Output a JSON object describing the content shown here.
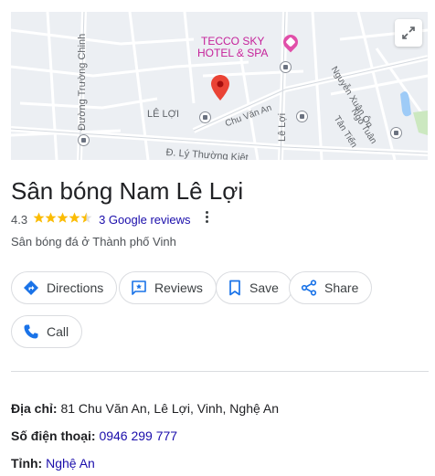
{
  "map": {
    "poi_name_line1": "TECCO SKY",
    "poi_name_line2": "HOTEL & SPA",
    "streets": {
      "duong_truong_chinh": "Đường Trường Chinh",
      "le_loi_area": "LÊ LỢI",
      "chu_van_an": "Chu Văn An",
      "le_loi_street": "Lê Lợi",
      "nguyen_xuan_on": "Nguyễn Xuân Ôn",
      "ngo_tuan": "Ngô Tuân",
      "tan_tien": "Tân Tiến",
      "ly_thuong_kiet": "Đ. Lý Thường Kiệt"
    },
    "icons": [
      "expand-icon",
      "location-pin-icon",
      "hotel-icon",
      "bus-stop-icon"
    ]
  },
  "place": {
    "title": "Sân bóng Nam Lê Lợi",
    "rating": "4.3",
    "stars": "★★★★★",
    "reviews_link": "3 Google reviews",
    "category": "Sân bóng đá ở Thành phố Vinh"
  },
  "actions": {
    "directions": "Directions",
    "reviews": "Reviews",
    "save": "Save",
    "share": "Share",
    "call": "Call"
  },
  "details": {
    "address_label": "Địa chỉ:",
    "address_value": "81 Chu Văn An, Lê Lợi, Vinh, Nghệ An",
    "phone_label": "Số điện thoại:",
    "phone_value": "0946 299 777",
    "province_label": "Tỉnh:",
    "province_value": "Nghệ An"
  },
  "colors": {
    "accent_link": "#1a0dab",
    "star": "#fbbc04",
    "pin": "#ea4335",
    "poi": "#c5229a",
    "map_bg": "#eceff3"
  }
}
